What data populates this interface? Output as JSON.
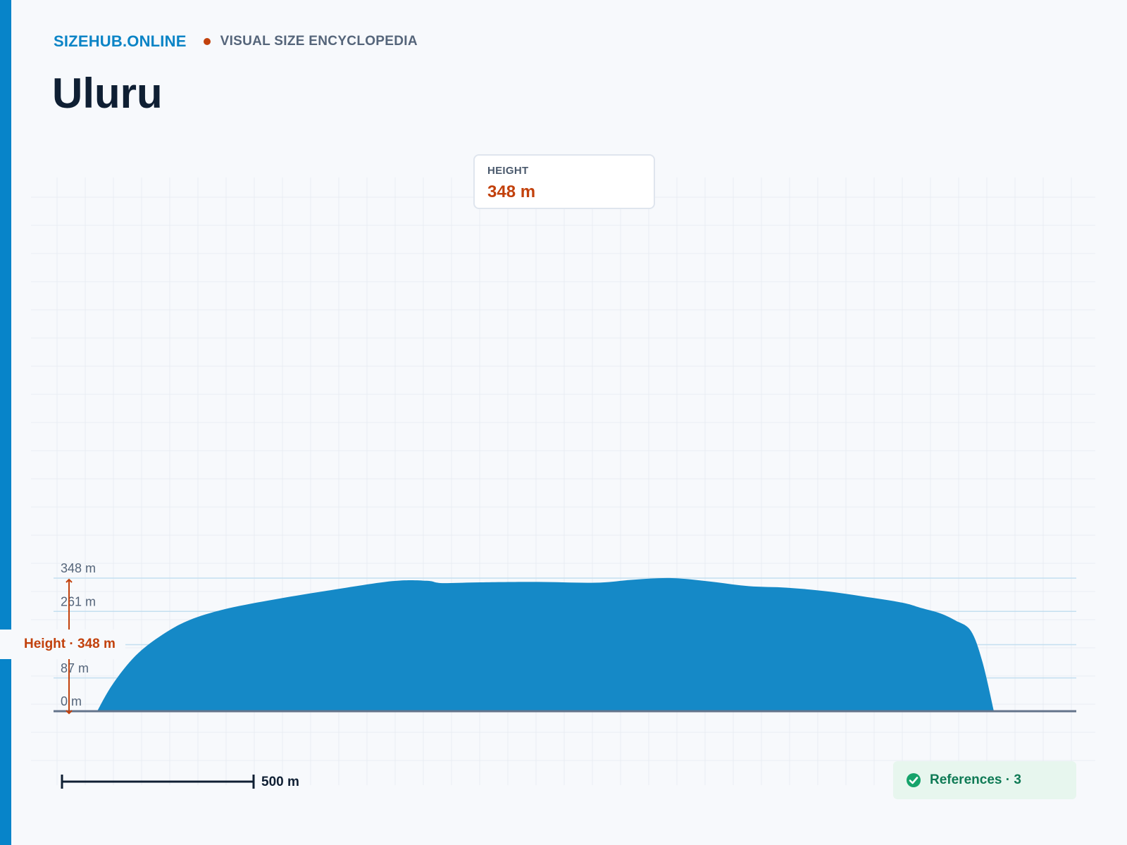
{
  "header": {
    "brand": "SIZEHUB.ONLINE",
    "tagline": "VISUAL SIZE ENCYCLOPEDIA",
    "title": "Uluru"
  },
  "height_card": {
    "label": "HEIGHT",
    "value": "348 m"
  },
  "ruler": {
    "label": "Height · 348 m"
  },
  "scale_bar": {
    "label": "500 m",
    "length_m": 500
  },
  "references": {
    "label": "References · 3",
    "icon": "check-circle-icon"
  },
  "colors": {
    "accent": "#0784c9",
    "shape": "#1589c7",
    "highlight": "#c2410c",
    "success": "#16a36b"
  },
  "chart_data": {
    "type": "area",
    "xlabel": "",
    "ylabel": "",
    "ylim": [
      0,
      348
    ],
    "y_ticks": [
      {
        "value": 0,
        "label": "0 m"
      },
      {
        "value": 87,
        "label": "87 m"
      },
      {
        "value": 174,
        "label": ""
      },
      {
        "value": 261,
        "label": "261 m"
      },
      {
        "value": 348,
        "label": "348 m"
      }
    ],
    "profile_x_m": [
      0,
      40,
      100,
      170,
      240,
      330,
      450,
      600,
      770,
      860,
      900,
      1000,
      1150,
      1300,
      1400,
      1500,
      1600,
      1700,
      1800,
      1900,
      2000,
      2100,
      2150,
      2200,
      2240,
      2280,
      2310,
      2340
    ],
    "profile_y_m": [
      0,
      70,
      145,
      200,
      238,
      266,
      290,
      315,
      340,
      341,
      335,
      337,
      338,
      336,
      344,
      348,
      339,
      327,
      323,
      314,
      300,
      284,
      270,
      256,
      237,
      210,
      130,
      0
    ]
  }
}
